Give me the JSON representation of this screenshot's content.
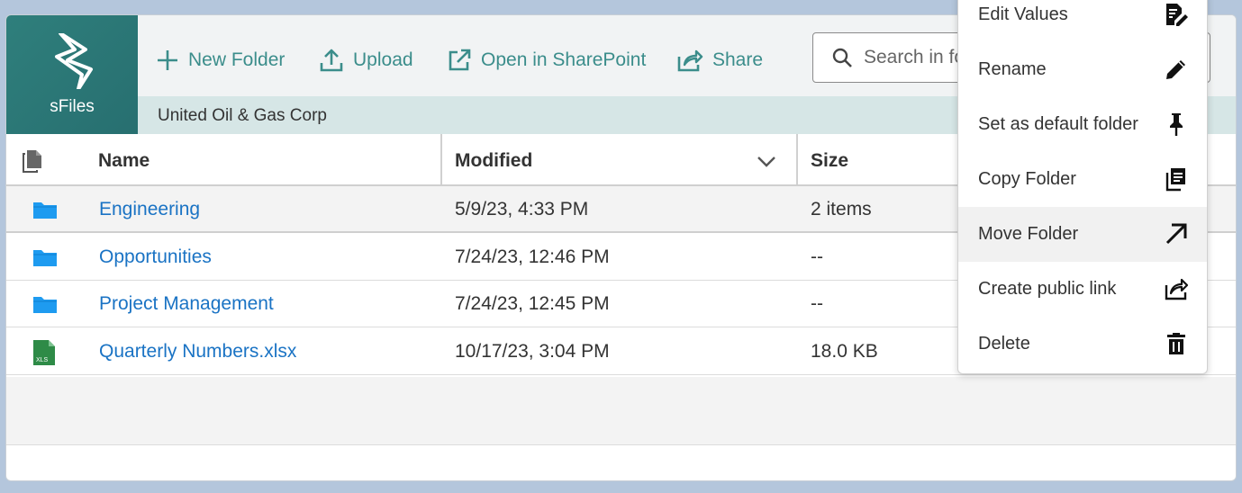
{
  "app": {
    "logo_text": "sFiles"
  },
  "toolbar": {
    "new_folder": "New Folder",
    "upload": "Upload",
    "open_in_sharepoint": "Open in SharePoint",
    "share": "Share"
  },
  "search": {
    "placeholder": "Search in folder"
  },
  "breadcrumb": "United Oil & Gas Corp",
  "table": {
    "columns": {
      "name": "Name",
      "modified": "Modified",
      "size": "Size"
    },
    "rows": [
      {
        "name": "Engineering",
        "modified": "5/9/23, 4:33 PM",
        "size": "2 items",
        "type": "folder-icon"
      },
      {
        "name": "Opportunities",
        "modified": "7/24/23, 12:46 PM",
        "size": "--",
        "type": "folder-icon"
      },
      {
        "name": "Project Management",
        "modified": "7/24/23, 12:45 PM",
        "size": "--",
        "type": "folder-icon"
      },
      {
        "name": "Quarterly Numbers.xlsx",
        "modified": "10/17/23, 3:04 PM",
        "size": "18.0 KB",
        "type": "excel-file-icon",
        "badge": "XLS"
      }
    ]
  },
  "context_menu": {
    "items": [
      {
        "label": "Edit Values",
        "icon": "edit-values-icon"
      },
      {
        "label": "Rename",
        "icon": "pencil-icon"
      },
      {
        "label": "Set as default folder",
        "icon": "pin-icon"
      },
      {
        "label": "Copy Folder",
        "icon": "copy-icon"
      },
      {
        "label": "Move Folder",
        "icon": "arrow-up-right-icon"
      },
      {
        "label": "Create public link",
        "icon": "share-link-icon"
      },
      {
        "label": "Delete",
        "icon": "trash-icon"
      }
    ]
  },
  "colors": {
    "accent": "#3b8d8b",
    "logo_bg": "#2f7f7c",
    "link": "#1a73c4",
    "folder": "#1e9bf0",
    "excel": "#2e8b47"
  }
}
